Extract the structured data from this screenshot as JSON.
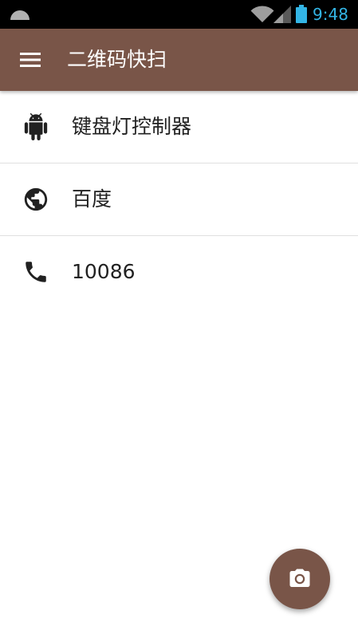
{
  "status_bar": {
    "time": "9:48",
    "time_color": "#33b5e5",
    "icons": [
      "notification-icon",
      "wifi-icon",
      "signal-icon",
      "battery-icon"
    ]
  },
  "app_bar": {
    "title": "二维码快扫",
    "menu_icon": "menu-icon",
    "background": "#795548"
  },
  "list": {
    "items": [
      {
        "icon": "android-icon",
        "label": "键盘灯控制器"
      },
      {
        "icon": "globe-icon",
        "label": "百度"
      },
      {
        "icon": "phone-icon",
        "label": "10086"
      }
    ]
  },
  "fab": {
    "icon": "camera-icon",
    "background": "#795548"
  }
}
